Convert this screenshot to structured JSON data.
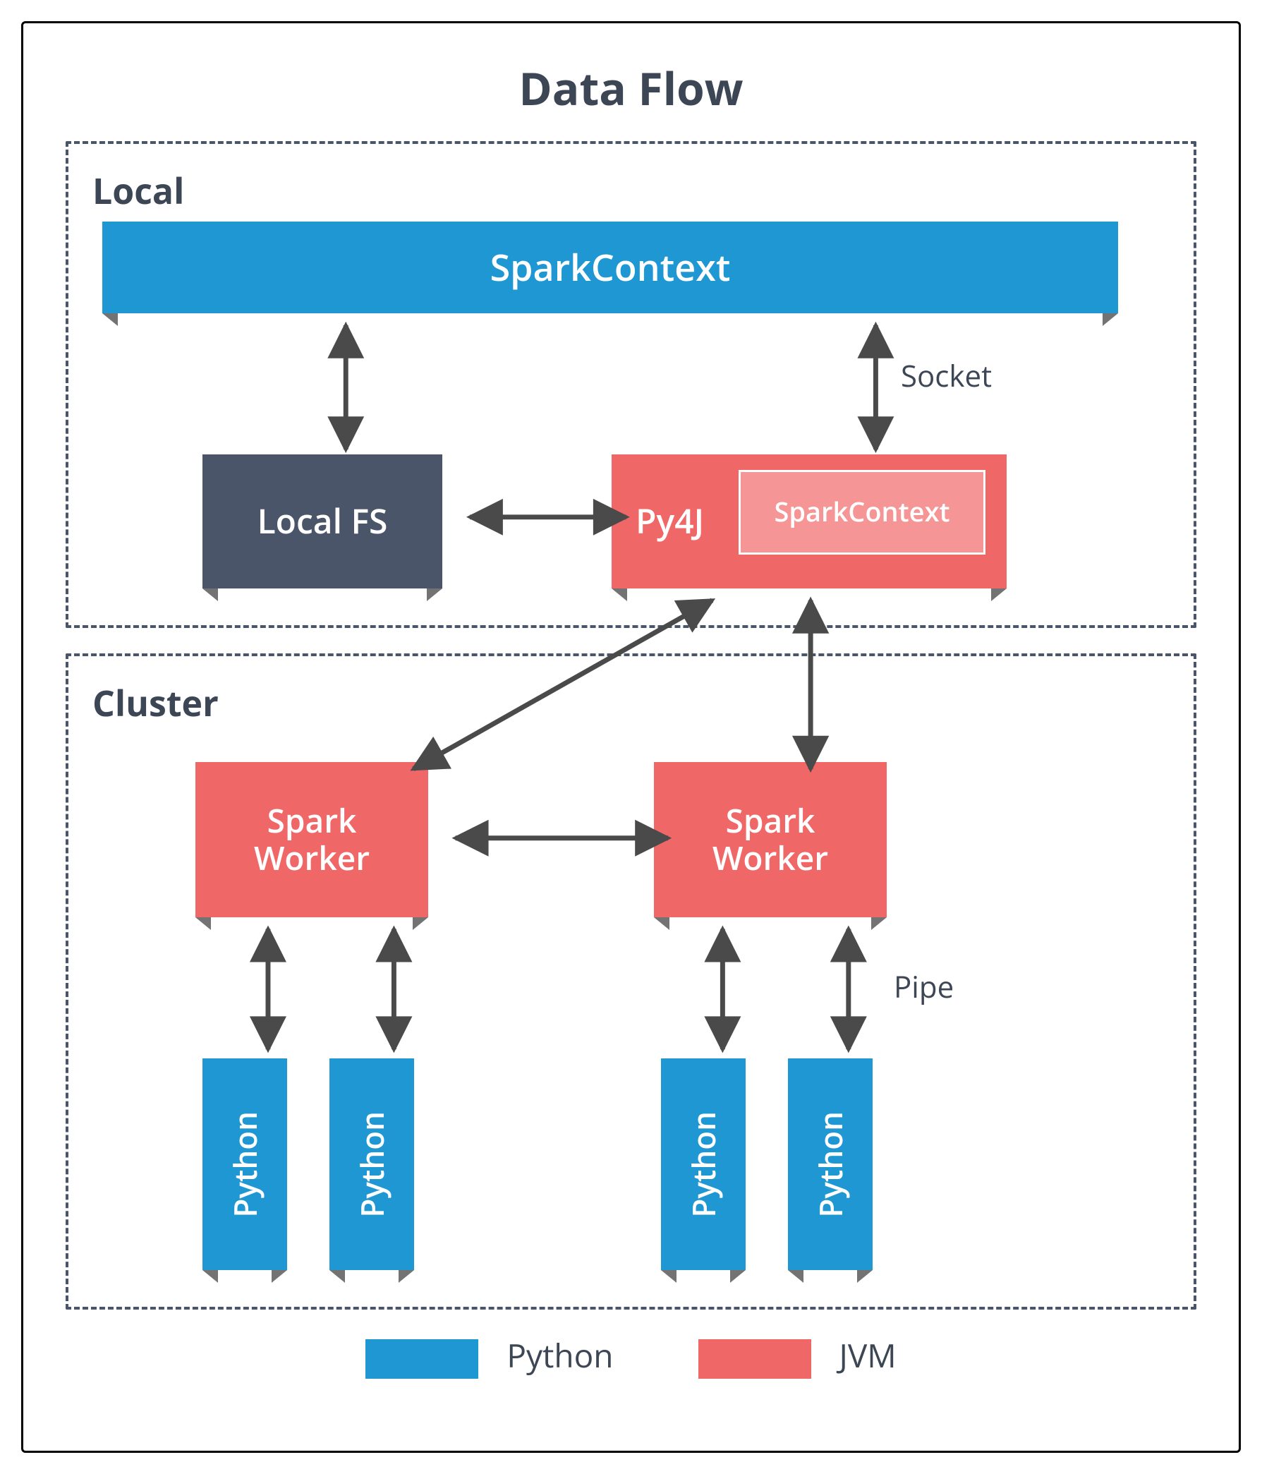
{
  "title": "Data Flow",
  "zones": {
    "local": {
      "label": "Local"
    },
    "cluster": {
      "label": "Cluster"
    }
  },
  "nodes": {
    "sparkcontext_py": "SparkContext",
    "localfs": "Local FS",
    "py4j": "Py4J",
    "sparkcontext_jvm": "SparkContext",
    "spark_worker_1": "Spark\nWorker",
    "spark_worker_2": "Spark\nWorker",
    "python": "Python"
  },
  "edge_labels": {
    "socket": "Socket",
    "pipe": "Pipe"
  },
  "legend": {
    "python": "Python",
    "jvm": "JVM"
  },
  "colors": {
    "python": "#1e97d2",
    "jvm": "#f06767",
    "neutral": "#4b5569"
  }
}
